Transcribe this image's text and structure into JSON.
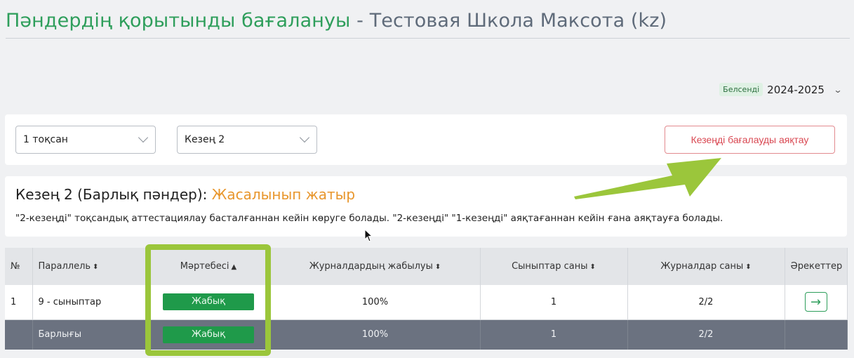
{
  "header": {
    "title_main": "Пәндердің қорытынды бағалануы",
    "title_separator": " - ",
    "title_school": "Тестовая Школа Максота (kz)"
  },
  "year_selector": {
    "badge": "Белсенді",
    "value": "2024-2025",
    "chevron_icon": "chevron-down-icon"
  },
  "filters": {
    "quarter_select": "1 тоқсан",
    "period_select": "Кезең 2",
    "finish_button": "Кезеңді бағалауды аяқтау"
  },
  "info": {
    "heading": "Кезең 2 (Барлық пәндер):",
    "status": "Жасалынып жатыр",
    "status_color": "#e8962c",
    "note": "\"2-кезеңді\" тоқсандық аттестациялау басталғаннан кейін көруге болады. \"2-кезеңді\" \"1-кезеңді\" аяқтағаннан кейін ғана аяқтауға болады."
  },
  "table": {
    "columns": [
      "№",
      "Параллель",
      "Мәртебесі",
      "Журналдардың жабылуы",
      "Сыныптар саны",
      "Журналдар саны",
      "Әрекеттер"
    ],
    "sort_icons": [
      "",
      "⬍",
      "▲",
      "⬍",
      "⬍",
      "⬍",
      ""
    ],
    "rows": [
      {
        "num": "1",
        "parallel": "9 - сыныптар",
        "status": "Жабық",
        "closure": "100%",
        "classes": "1",
        "journals": "2/2",
        "action_icon": "arrow-right-icon"
      }
    ],
    "total": {
      "num": "",
      "parallel": "Барлығы",
      "status": "Жабық",
      "closure": "100%",
      "classes": "1",
      "journals": "2/2"
    }
  },
  "colors": {
    "accent_green": "#2e9e5b",
    "status_green": "#1f9a4a",
    "danger_red": "#d94852",
    "highlight_lime": "#9bc63b"
  }
}
